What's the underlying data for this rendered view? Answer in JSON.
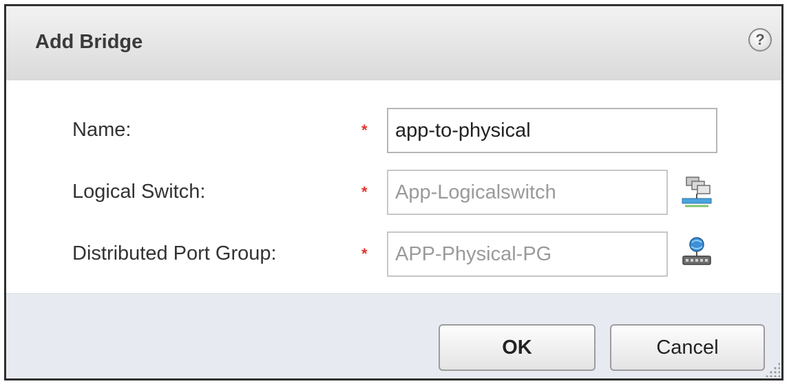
{
  "dialog": {
    "title": "Add Bridge",
    "help_icon": "?",
    "help_icon_name": "help-icon"
  },
  "form": {
    "required_marker": "*",
    "required_color": "#e0342b",
    "fields": [
      {
        "label": "Name:",
        "value": "app-to-physical",
        "editable": true
      },
      {
        "label": "Logical Switch:",
        "value": "App-Logicalswitch",
        "editable": false,
        "picker_icon": "logical-switch-picker-icon"
      },
      {
        "label": "Distributed Port Group:",
        "value": "APP-Physical-PG",
        "editable": false,
        "picker_icon": "port-group-picker-icon"
      }
    ]
  },
  "footer": {
    "ok_label": "OK",
    "cancel_label": "Cancel",
    "background": "#e7ebf1"
  }
}
